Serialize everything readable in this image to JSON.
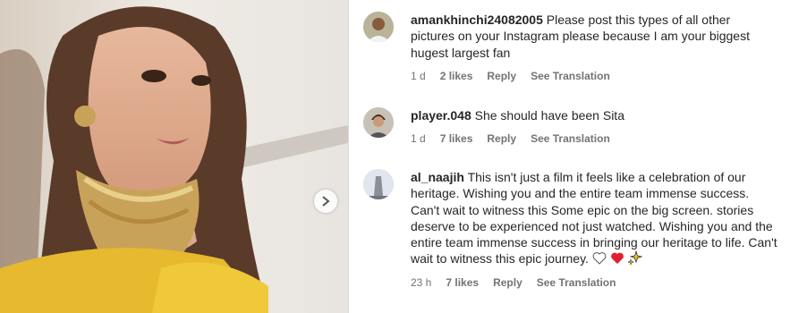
{
  "post": {
    "carousel_next_icon": "chevron-right-icon"
  },
  "comments": [
    {
      "username": "amankhinchi24082005",
      "text": "Please post this types of all other pictures on your Instagram please because I am your biggest hugest largest fan",
      "time": "1 d",
      "likes": "2 likes",
      "reply": "Reply",
      "see_translation": "See Translation"
    },
    {
      "username": "player.048",
      "text": "She should have been Sita",
      "time": "1 d",
      "likes": "7 likes",
      "reply": "Reply",
      "see_translation": "See Translation"
    },
    {
      "username": "al_naajih",
      "text": "This isn't just a film it feels like a celebration of our heritage. Wishing you and the entire team immense success. Can't wait to witness this Some epic on the big screen. stories deserve to be experienced not just watched. Wishing you and the entire team immense success in bringing our heritage to life. Can't wait to witness this epic journey.",
      "emojis": [
        "white-heart-icon",
        "red-heart-icon",
        "sparkles-icon"
      ],
      "time": "23 h",
      "likes": "7 likes",
      "reply": "Reply",
      "see_translation": "See Translation"
    }
  ]
}
